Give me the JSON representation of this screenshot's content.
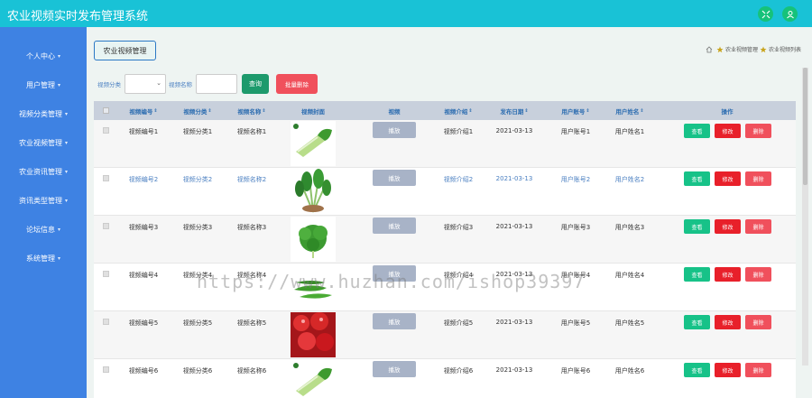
{
  "header": {
    "title": "农业视频实时发布管理系统",
    "icons": [
      "shrink-icon",
      "user-icon"
    ]
  },
  "sidebar": {
    "items": [
      {
        "label": "个人中心"
      },
      {
        "label": "用户管理"
      },
      {
        "label": "视频分类管理"
      },
      {
        "label": "农业视频管理"
      },
      {
        "label": "农业资讯管理"
      },
      {
        "label": "资讯类型管理"
      },
      {
        "label": "论坛信息"
      },
      {
        "label": "系统管理"
      }
    ]
  },
  "page": {
    "title": "农业视频管理",
    "breadcrumb": [
      "农业视频管理",
      "农业视频列表"
    ]
  },
  "search": {
    "category_label": "视频分类",
    "name_label": "视频名称",
    "query_button": "查询",
    "batch_delete_button": "批量删除"
  },
  "table": {
    "columns": [
      "视频编号",
      "视频分类",
      "视频名称",
      "视频封面",
      "视频",
      "视频介绍",
      "发布日期",
      "用户账号",
      "用户姓名",
      "操作"
    ],
    "rows": [
      {
        "code": "视频编号1",
        "category": "视频分类1",
        "name": "视频名称1",
        "play": "播放",
        "intro": "视频介绍1",
        "date": "2021-03-13",
        "account": "用户账号1",
        "username": "用户姓名1",
        "cover": "celery"
      },
      {
        "code": "视频编号2",
        "category": "视频分类2",
        "name": "视频名称2",
        "play": "播放",
        "intro": "视频介绍2",
        "date": "2021-03-13",
        "account": "用户账号2",
        "username": "用户姓名2",
        "cover": "spinach"
      },
      {
        "code": "视频编号3",
        "category": "视频分类3",
        "name": "视频名称3",
        "play": "播放",
        "intro": "视频介绍3",
        "date": "2021-03-13",
        "account": "用户账号3",
        "username": "用户姓名3",
        "cover": "greens"
      },
      {
        "code": "视频编号4",
        "category": "视频分类4",
        "name": "视频名称4",
        "play": "播放",
        "intro": "视频介绍4",
        "date": "2021-03-13",
        "account": "用户账号4",
        "username": "用户姓名4",
        "cover": "peppers"
      },
      {
        "code": "视频编号5",
        "category": "视频分类5",
        "name": "视频名称5",
        "play": "播放",
        "intro": "视频介绍5",
        "date": "2021-03-13",
        "account": "用户账号5",
        "username": "用户姓名5",
        "cover": "tomatoes"
      },
      {
        "code": "视频编号6",
        "category": "视频分类6",
        "name": "视频名称6",
        "play": "播放",
        "intro": "视频介绍6",
        "date": "2021-03-13",
        "account": "用户账号6",
        "username": "用户姓名6",
        "cover": "celery"
      }
    ],
    "actions": {
      "view": "查看",
      "edit": "修改",
      "delete": "删除"
    }
  },
  "watermark": "https://www.huzhan.com/ishop39397",
  "colors": {
    "header": "#19c2d6",
    "sidebar": "#3e82e3",
    "view": "#17c288",
    "edit": "#e8202a",
    "delete": "#f0505c",
    "query": "#1d9a6c"
  }
}
